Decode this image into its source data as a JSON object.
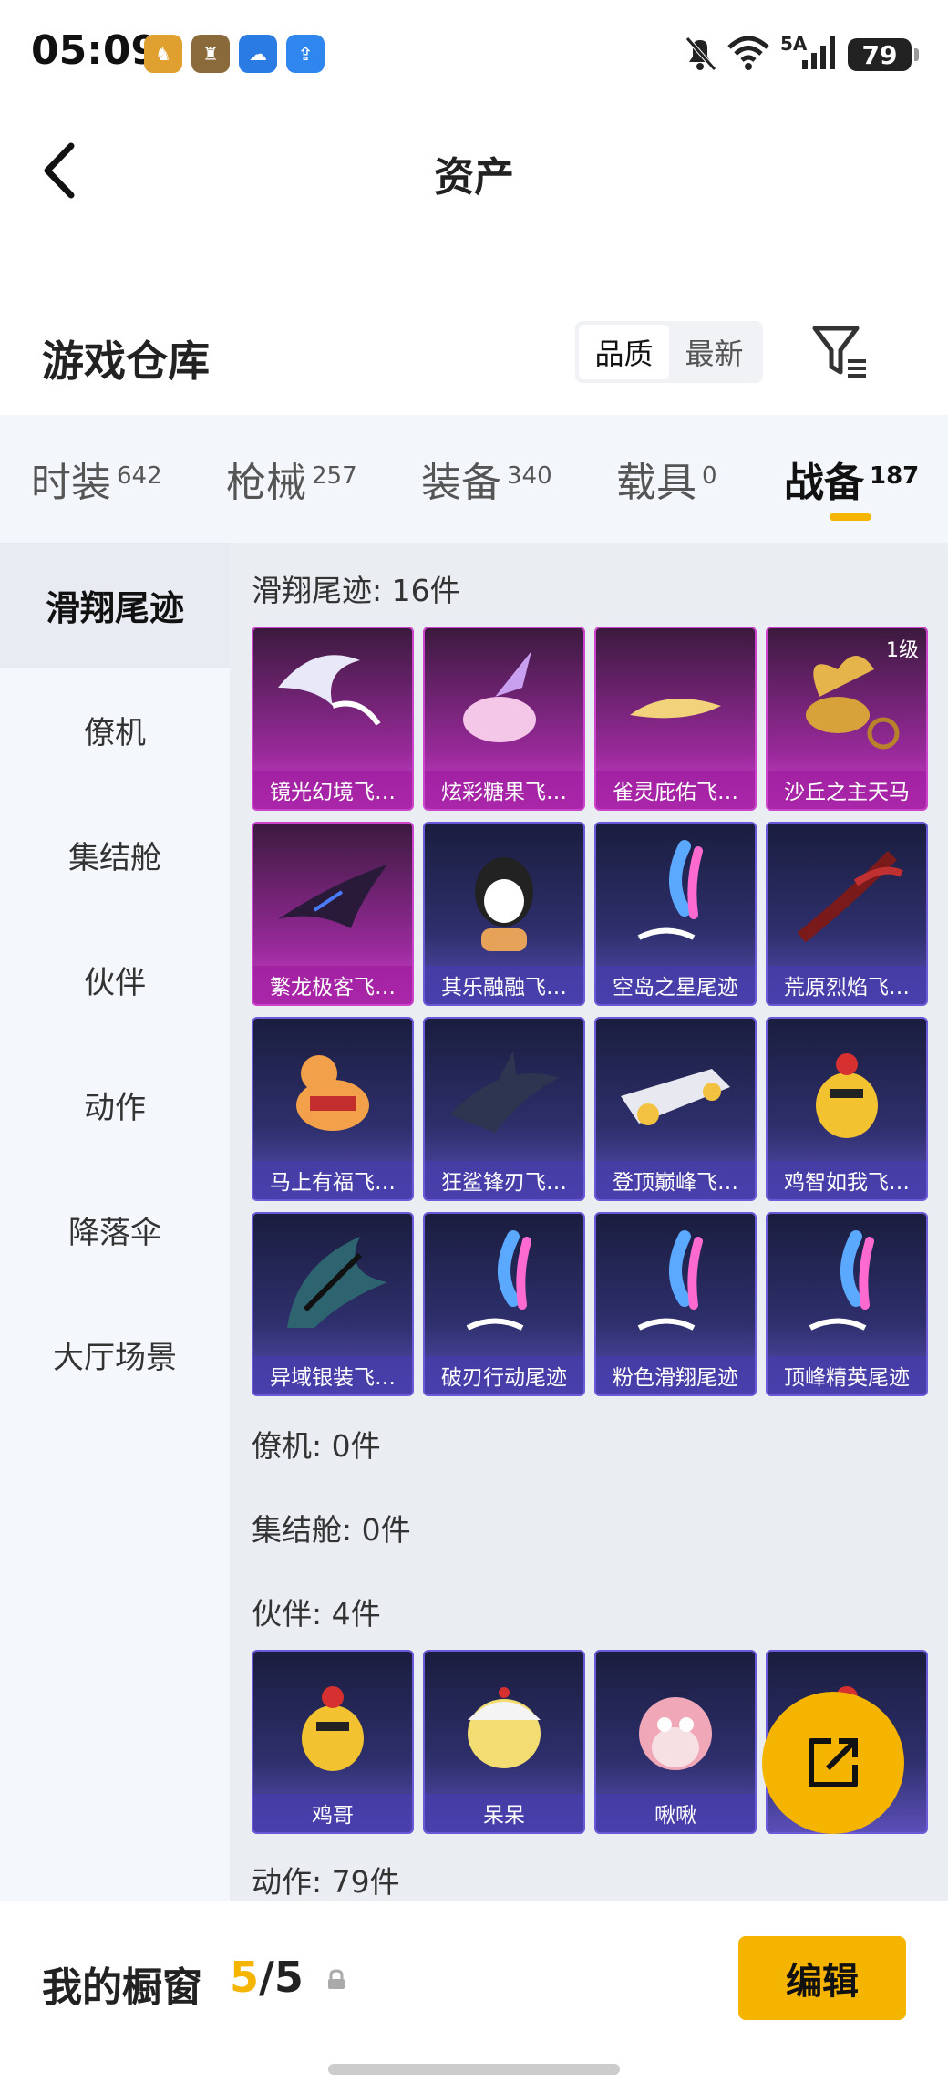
{
  "status": {
    "time": "05:09",
    "network": "5A",
    "battery": "79"
  },
  "nav": {
    "title": "资产"
  },
  "header": {
    "warehouse": "游戏仓库",
    "sort_options": [
      "品质",
      "最新"
    ],
    "sort_active": "品质"
  },
  "categories": [
    {
      "label": "时装",
      "count": "642"
    },
    {
      "label": "枪械",
      "count": "257"
    },
    {
      "label": "装备",
      "count": "340"
    },
    {
      "label": "载具",
      "count": "0"
    },
    {
      "label": "战备",
      "count": "187"
    }
  ],
  "category_active": "战备",
  "sidebar": [
    "滑翔尾迹",
    "僚机",
    "集结舱",
    "伙伴",
    "动作",
    "降落伞",
    "大厅场景"
  ],
  "sidebar_active": "滑翔尾迹",
  "sections": {
    "glide": {
      "title": "滑翔尾迹: 16件",
      "items": [
        {
          "name": "镜光幻境飞…",
          "tier": "purple",
          "art": "wings-icon"
        },
        {
          "name": "炫彩糖果飞…",
          "tier": "purple",
          "art": "candy-icon"
        },
        {
          "name": "雀灵庇佑飞…",
          "tier": "purple",
          "art": "feather-icon"
        },
        {
          "name": "沙丘之主天马",
          "tier": "purple",
          "art": "pegasus-icon",
          "level": "1级"
        },
        {
          "name": "繁龙极客飞…",
          "tier": "purple",
          "art": "dragon-wing-icon"
        },
        {
          "name": "其乐融融飞…",
          "tier": "blue",
          "art": "penguin-icon"
        },
        {
          "name": "空岛之星尾迹",
          "tier": "blue",
          "art": "smoke-trail-icon"
        },
        {
          "name": "荒原烈焰飞…",
          "tier": "blue",
          "art": "flame-wing-icon"
        },
        {
          "name": "马上有福飞…",
          "tier": "blue",
          "art": "horse-toy-icon"
        },
        {
          "name": "狂鲨锋刃飞…",
          "tier": "blue",
          "art": "shark-icon"
        },
        {
          "name": "登顶巅峰飞…",
          "tier": "blue",
          "art": "jet-icon"
        },
        {
          "name": "鸡智如我飞…",
          "tier": "blue",
          "art": "chicken-icon"
        },
        {
          "name": "异域银装飞…",
          "tier": "blue",
          "art": "armor-wing-icon"
        },
        {
          "name": "破刃行动尾迹",
          "tier": "blue",
          "art": "smoke-trail-icon"
        },
        {
          "name": "粉色滑翔尾迹",
          "tier": "blue",
          "art": "smoke-trail-icon"
        },
        {
          "name": "顶峰精英尾迹",
          "tier": "blue",
          "art": "smoke-trail-icon"
        }
      ]
    },
    "wingman": {
      "title": "僚机: 0件"
    },
    "pod": {
      "title": "集结舱: 0件"
    },
    "partner": {
      "title": "伙伴: 4件",
      "items": [
        {
          "name": "鸡哥",
          "tier": "blue",
          "art": "chicken-icon"
        },
        {
          "name": "呆呆",
          "tier": "blue",
          "art": "chick-icon"
        },
        {
          "name": "啾啾",
          "tier": "blue",
          "art": "bird-icon"
        },
        {
          "name": "",
          "tier": "blue",
          "art": "chicken-icon"
        }
      ]
    },
    "emote": {
      "title": "动作: 79件"
    }
  },
  "bottom": {
    "showcase": "我的橱窗",
    "current": "5",
    "total": "/5",
    "edit": "编辑"
  },
  "colors": {
    "accent": "#f5b400",
    "purple_tier": "#c040c0",
    "blue_tier": "#5b4fb8"
  }
}
